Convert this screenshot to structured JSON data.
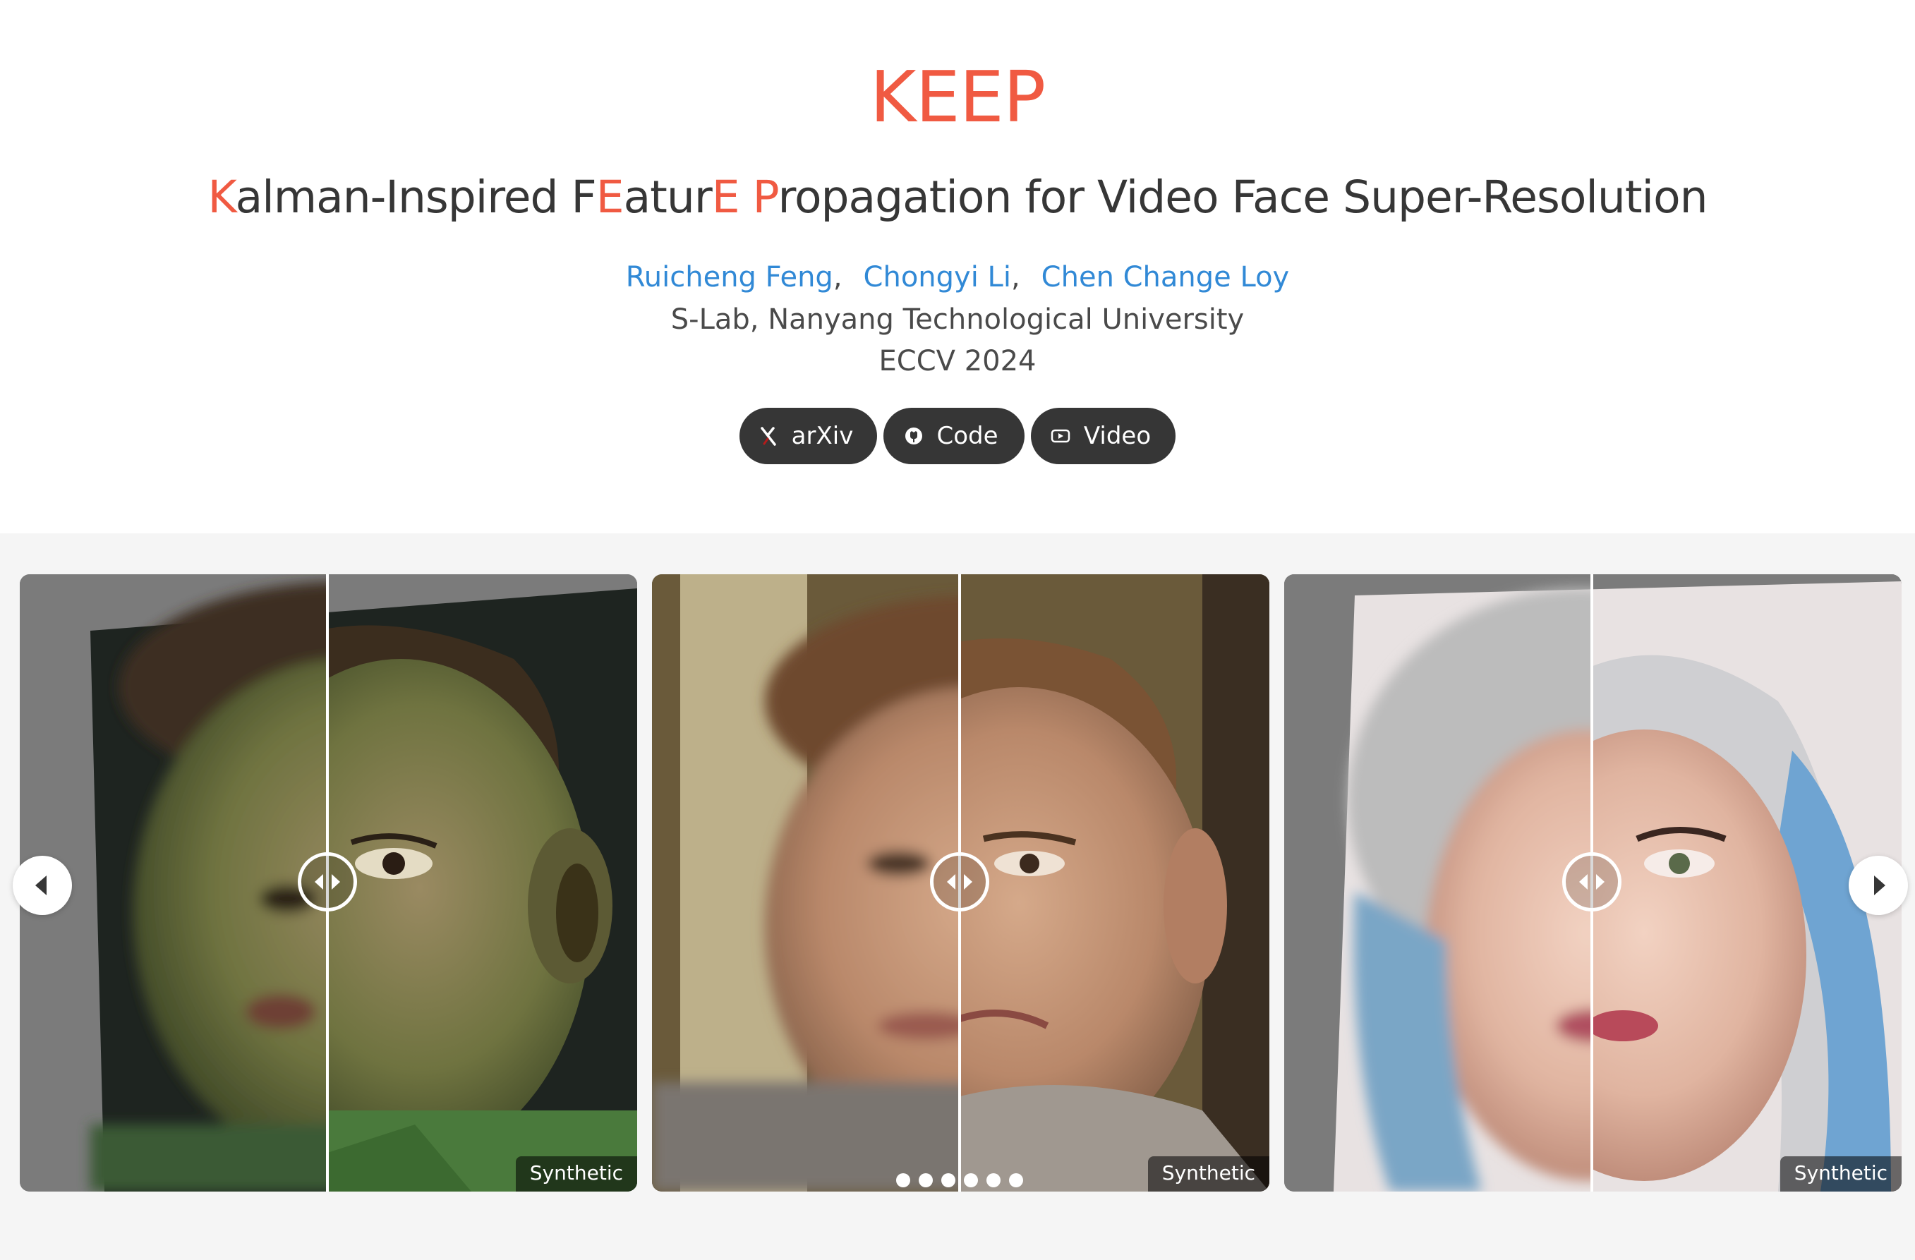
{
  "header": {
    "title": "KEEP",
    "subtitle_parts": [
      {
        "text": "K",
        "highlight": true
      },
      {
        "text": "alman-Inspired F",
        "highlight": false
      },
      {
        "text": "E",
        "highlight": true
      },
      {
        "text": "atur",
        "highlight": false
      },
      {
        "text": "E",
        "highlight": true
      },
      {
        "text": " ",
        "highlight": false
      },
      {
        "text": "P",
        "highlight": true
      },
      {
        "text": "ropagation for Video Face Super-Resolution",
        "highlight": false
      }
    ],
    "authors": [
      "Ruicheng Feng",
      "Chongyi Li",
      "Chen Change Loy"
    ],
    "author_separator": ",",
    "affiliation": "S-Lab, Nanyang Technological University",
    "venue": "ECCV 2024",
    "accent_color": "#f05a42",
    "link_color": "#3189d6"
  },
  "links": [
    {
      "label": "arXiv",
      "icon": "arxiv-icon"
    },
    {
      "label": "Code",
      "icon": "github-icon"
    },
    {
      "label": "Video",
      "icon": "youtube-icon"
    }
  ],
  "carousel": {
    "cards": [
      {
        "tag": "Synthetic",
        "subject": "boy-face-comparison",
        "slider_position": 0.5
      },
      {
        "tag": "Synthetic",
        "subject": "man-face-comparison",
        "slider_position": 0.5
      },
      {
        "tag": "Synthetic",
        "subject": "woman-face-comparison",
        "slider_position": 0.5
      }
    ],
    "page_count": 6,
    "prev_icon": "chevron-left-icon",
    "next_icon": "chevron-right-icon"
  }
}
